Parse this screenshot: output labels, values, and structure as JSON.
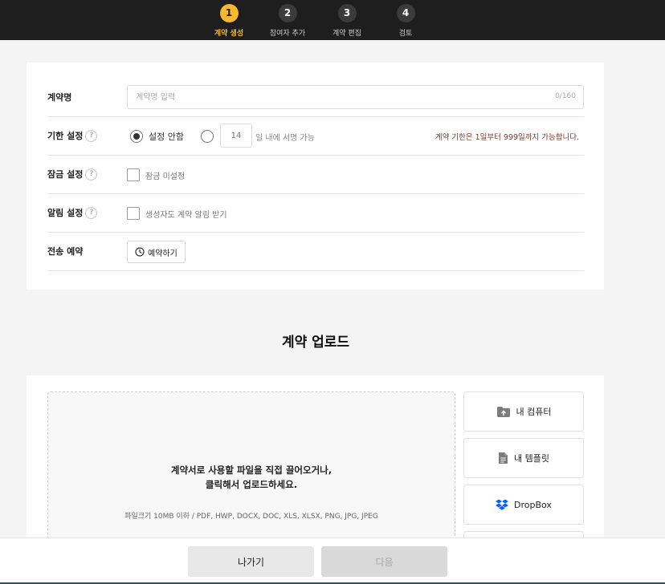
{
  "stepper": {
    "steps": [
      {
        "number": "1",
        "label": "계약 생성",
        "active": true
      },
      {
        "number": "2",
        "label": "참여자 추가",
        "active": false
      },
      {
        "number": "3",
        "label": "계약 편집",
        "active": false
      },
      {
        "number": "4",
        "label": "검토",
        "active": false
      }
    ],
    "active_color": "#f5b82e"
  },
  "settings": {
    "contract_name": {
      "label": "계약명",
      "placeholder": "계약명 입력",
      "value": "",
      "counter": "0/160"
    },
    "deadline": {
      "label": "기한 설정",
      "help": "?",
      "option_none": "설정 안함",
      "option_none_selected": true,
      "days_value": "14",
      "days_suffix": "일 내에 서명 가능",
      "note": "계약 기한은 1일부터 999일까지 가능합니다."
    },
    "lock": {
      "label": "잠금 설정",
      "help": "?",
      "checkbox_label": "잠금 미설정",
      "checked": false
    },
    "notify": {
      "label": "알림 설정",
      "help": "?",
      "checkbox_label": "생성자도 계약 알림 받기",
      "checked": false
    },
    "schedule": {
      "label": "전송 예약",
      "button_label": "예약하기"
    }
  },
  "upload": {
    "title": "계약 업로드",
    "drop_line1": "계약서로 사용할 파일을 직접 끌어오거나,",
    "drop_line2": "클릭해서 업로드하세요.",
    "drop_sub": "파일크기 10MB 이하 / PDF, HWP, DOCX, DOC, XLS, XLSX, PNG, JPG, JPEG",
    "sources": [
      {
        "label": "내 컴퓨터",
        "icon": "folder-upload-icon"
      },
      {
        "label": "내 템플릿",
        "icon": "document-icon"
      },
      {
        "label": "DropBox",
        "icon": "dropbox-icon"
      }
    ]
  },
  "footer": {
    "exit_label": "나가기",
    "next_label": "다음"
  },
  "colors": {
    "deadline_note": "#7a3b2a",
    "dropbox_blue": "#0061fe"
  }
}
